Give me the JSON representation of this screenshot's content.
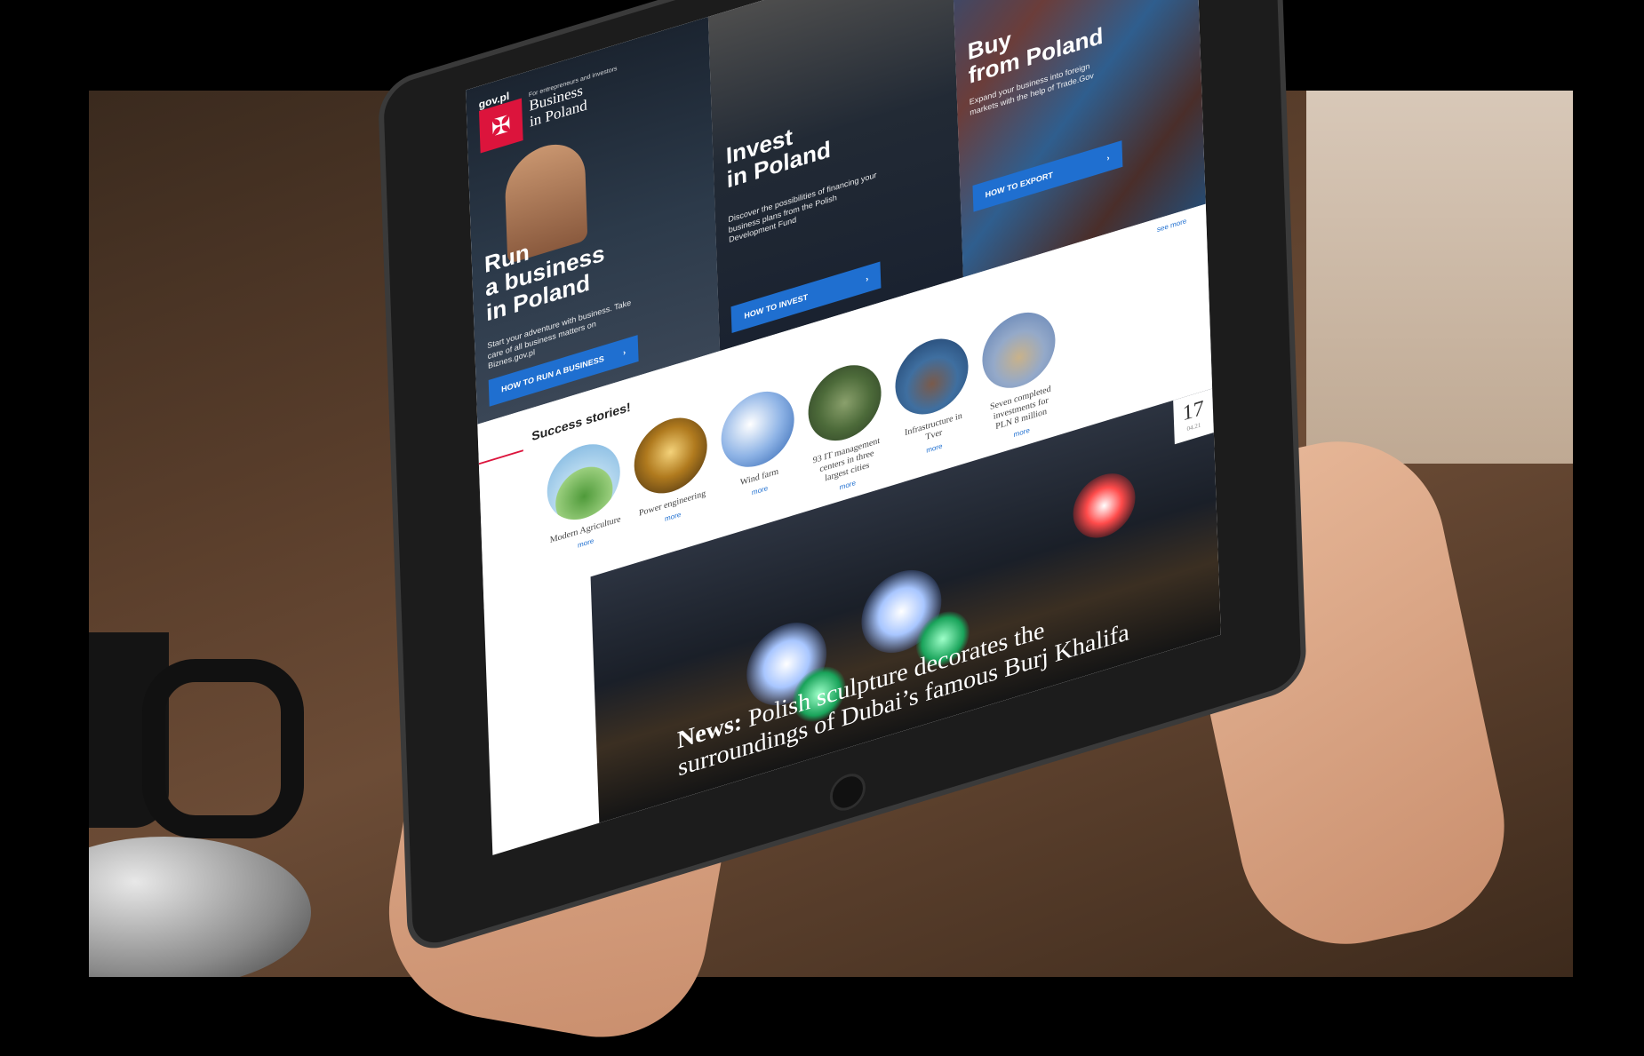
{
  "site": {
    "gov": "gov.pl",
    "tagline": "For entrepreneurs and investors",
    "brand_line1": "Business",
    "brand_line2": "in Poland"
  },
  "panels": [
    {
      "title_line1": "Run",
      "title_line2": "a business",
      "title_line3": "in Poland",
      "desc": "Start your adventure with business. Take care of all business matters on Biznes.gov.pl",
      "button": "HOW TO RUN A BUSINESS"
    },
    {
      "title_line1": "Invest",
      "title_line2": "in Poland",
      "desc": "Discover the possibilities of financing your business plans from the Polish Development Fund",
      "button": "HOW TO INVEST"
    },
    {
      "title_line1": "Buy",
      "title_line2": "from Poland",
      "desc": "Expand your business into foreign markets with the help of Trade.Gov",
      "button": "HOW TO EXPORT"
    }
  ],
  "stories": {
    "title": "Success stories!",
    "see_all": "see more",
    "items": [
      {
        "label": "Modern Agriculture",
        "more": "more"
      },
      {
        "label": "Power engineering",
        "more": "more"
      },
      {
        "label": "Wind farm",
        "more": "more"
      },
      {
        "label": "93 IT management centers in three largest cities",
        "more": "more"
      },
      {
        "label": "Infrastructure in Tver",
        "more": "more"
      },
      {
        "label": "Seven completed investments for PLN 8 million",
        "more": "more"
      }
    ]
  },
  "news": {
    "date_day": "17",
    "date_month": "04.21",
    "prefix": "News:",
    "headline": "Polish sculpture decorates the surroundings of Dubai’s famous Burj Khalifa"
  }
}
